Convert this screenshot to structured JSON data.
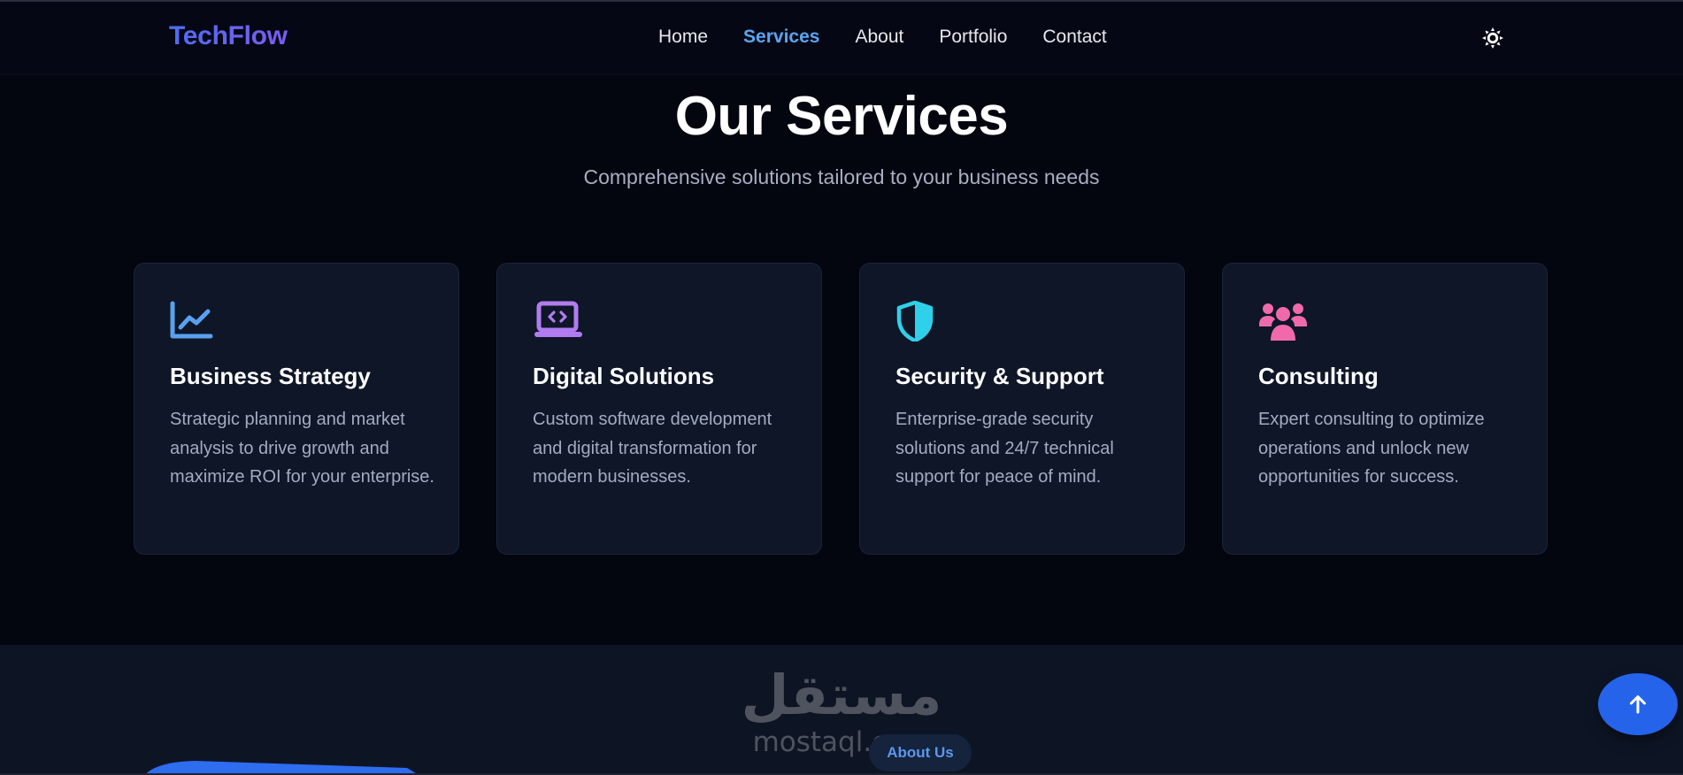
{
  "brand": {
    "name": "TechFlow"
  },
  "nav": {
    "items": [
      {
        "label": "Home"
      },
      {
        "label": "Services",
        "active": true
      },
      {
        "label": "About"
      },
      {
        "label": "Portfolio"
      },
      {
        "label": "Contact"
      }
    ],
    "theme_toggle_icon": "sun-icon"
  },
  "services": {
    "title": "Our Services",
    "subtitle": "Comprehensive solutions tailored to your business needs",
    "cards": [
      {
        "icon": "chart-line-icon",
        "icon_color": "#5aa0f0",
        "title": "Business Strategy",
        "description": "Strategic planning and market analysis to drive growth and maximize ROI for your enterprise."
      },
      {
        "icon": "laptop-code-icon",
        "icon_color": "#b07cf0",
        "title": "Digital Solutions",
        "description": "Custom software development and digital transformation for modern businesses."
      },
      {
        "icon": "shield-icon",
        "icon_color": "#2fd0ea",
        "title": "Security & Support",
        "description": "Enterprise-grade security solutions and 24/7 technical support for peace of mind."
      },
      {
        "icon": "users-icon",
        "icon_color": "#f06aab",
        "title": "Consulting",
        "description": "Expert consulting to optimize operations and unlock new opportunities for success."
      }
    ]
  },
  "about": {
    "pill_label": "About Us"
  },
  "watermark": {
    "arabic": "مستقل",
    "latin": "mostaql.com"
  },
  "scroll_top": {
    "icon": "arrow-up-icon",
    "color": "#2563eb"
  }
}
